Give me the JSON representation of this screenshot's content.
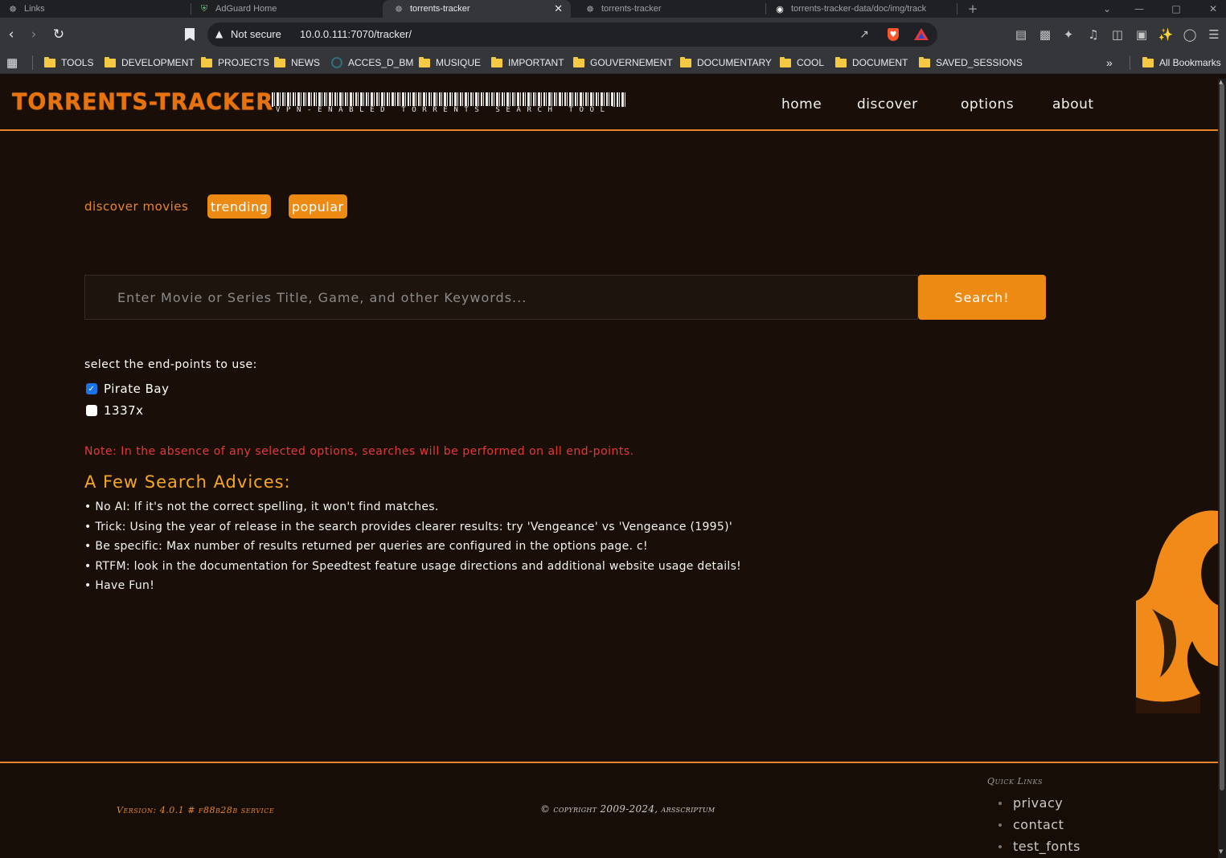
{
  "browser": {
    "tabs": [
      {
        "title": "Links",
        "icon": "torrent-icon",
        "active": false
      },
      {
        "title": "AdGuard Home",
        "icon": "shield-icon",
        "active": false
      },
      {
        "title": "torrents-tracker",
        "icon": "torrent-icon",
        "active": true
      },
      {
        "title": "torrents-tracker",
        "icon": "torrent-icon",
        "active": false
      },
      {
        "title": "torrents-tracker-data/doc/img/track",
        "icon": "github-icon",
        "active": false
      }
    ],
    "security_status": "Not secure",
    "url": "10.0.0.111:7070/tracker/",
    "bookmarks": [
      "TOOLS",
      "DEVELOPMENT",
      "PROJECTS",
      "NEWS",
      "ACCES_D_BM",
      "MUSIQUE",
      "IMPORTANT",
      "GOUVERNEMENT",
      "DOCUMENTARY",
      "COOL",
      "DOCUMENT",
      "SAVED_SESSIONS"
    ],
    "all_bookmarks": "All Bookmarks",
    "overflow": "»"
  },
  "site": {
    "logo": "TORRENTS-TRACKER",
    "tagline": "VPN-ENABLED TORRENTS SEARCH TOOL",
    "nav": [
      "home",
      "discover",
      "options",
      "about"
    ]
  },
  "discover": {
    "label": "discover movies",
    "buttons": [
      "trending",
      "popular"
    ]
  },
  "search": {
    "placeholder": "Enter Movie or Series Title, Game, and other Keywords...",
    "button": "Search!"
  },
  "endpoints": {
    "label": "select the end-points to use:",
    "options": [
      {
        "name": "Pirate Bay",
        "checked": true
      },
      {
        "name": "1337x",
        "checked": false
      }
    ]
  },
  "note": "Note: In the absence of any selected options, searches will be performed on all end-points.",
  "advice": {
    "title": "A Few Search Advices:",
    "items": [
      "No AI: If it's not the correct spelling, it won't find matches.",
      "Trick: Using the year of release in the search provides clearer results: try 'Vengeance' vs 'Vengeance (1995)'",
      "Be specific: Max number of results returned per queries are configured in the options page. c!",
      "RTFM: look in the documentation for Speedtest feature usage directions and additional website usage details!",
      "Have Fun!"
    ]
  },
  "footer": {
    "version": "Version: 4.0.1 # f88b28b service",
    "copyright": "© copyright 2009-2024, arsscriptum",
    "quick_links_title": "Quick Links",
    "quick_links": [
      "privacy",
      "contact",
      "test_fonts"
    ]
  },
  "colors": {
    "accent": "#ec8a13",
    "page_bg": "#1a0f08",
    "note_red": "#e23a3a",
    "advice_title": "#f5a623"
  }
}
